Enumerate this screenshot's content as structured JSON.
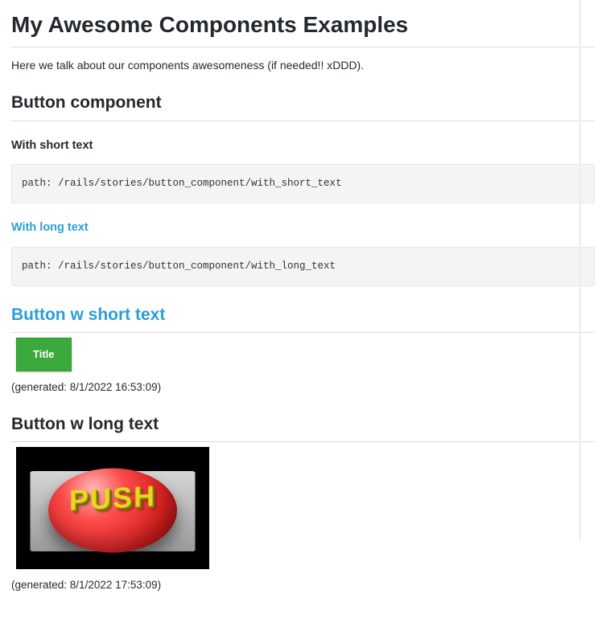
{
  "page": {
    "title": "My Awesome Components Examples",
    "intro": "Here we talk about our components awesomeness (if needed!! xDDD)."
  },
  "button_component": {
    "heading": "Button component",
    "short": {
      "heading": "With short text",
      "code": "path: /rails/stories/button_component/with_short_text"
    },
    "long": {
      "heading": "With long text",
      "code": "path: /rails/stories/button_component/with_long_text"
    }
  },
  "example_short": {
    "heading": "Button w short text",
    "button_label": "Title",
    "generated": "(generated: 8/1/2022 16:53:09)"
  },
  "example_long": {
    "heading": "Button w long text",
    "push_label": "PUSH",
    "generated": "(generated: 8/1/2022 17:53:09)"
  }
}
